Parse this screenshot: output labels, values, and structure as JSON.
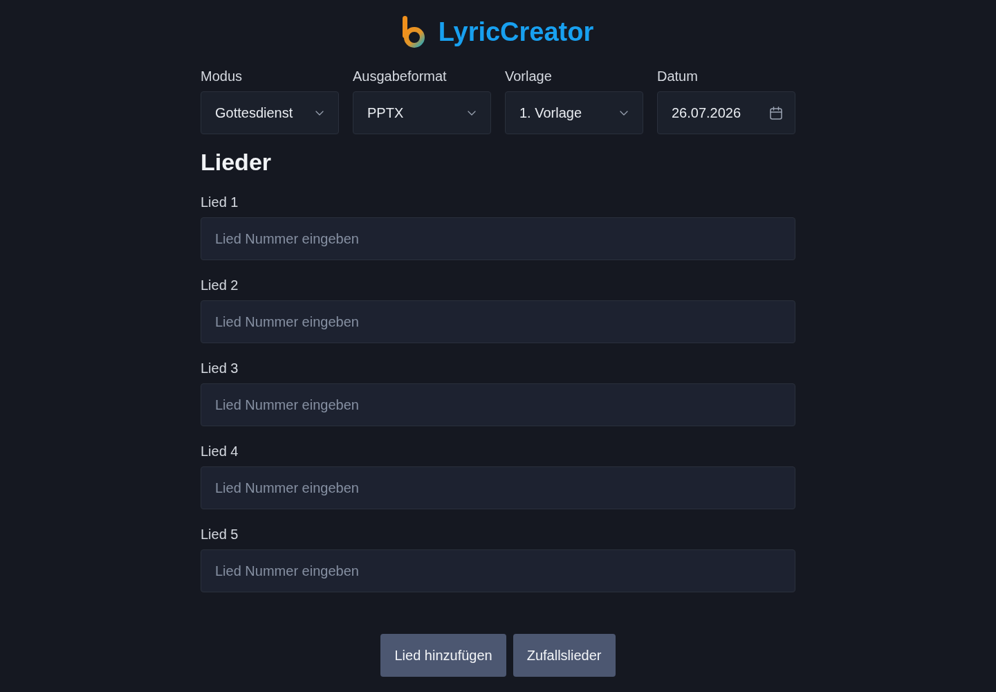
{
  "header": {
    "logo_text": "LyricCreator"
  },
  "settings": [
    {
      "kind": "select",
      "label": "Modus",
      "value": "Gottesdienst"
    },
    {
      "kind": "select",
      "label": "Ausgabeformat",
      "value": "PPTX"
    },
    {
      "kind": "select",
      "label": "Vorlage",
      "value": "1. Vorlage"
    },
    {
      "kind": "date",
      "label": "Datum",
      "value": "26.07.2026"
    }
  ],
  "section_title": "Lieder",
  "songs": [
    {
      "label": "Lied 1",
      "placeholder": "Lied Nummer eingeben"
    },
    {
      "label": "Lied 2",
      "placeholder": "Lied Nummer eingeben"
    },
    {
      "label": "Lied 3",
      "placeholder": "Lied Nummer eingeben"
    },
    {
      "label": "Lied 4",
      "placeholder": "Lied Nummer eingeben"
    },
    {
      "label": "Lied 5",
      "placeholder": "Lied Nummer eingeben"
    }
  ],
  "buttons": [
    "Lied hinzufügen",
    "Zufallslieder"
  ]
}
